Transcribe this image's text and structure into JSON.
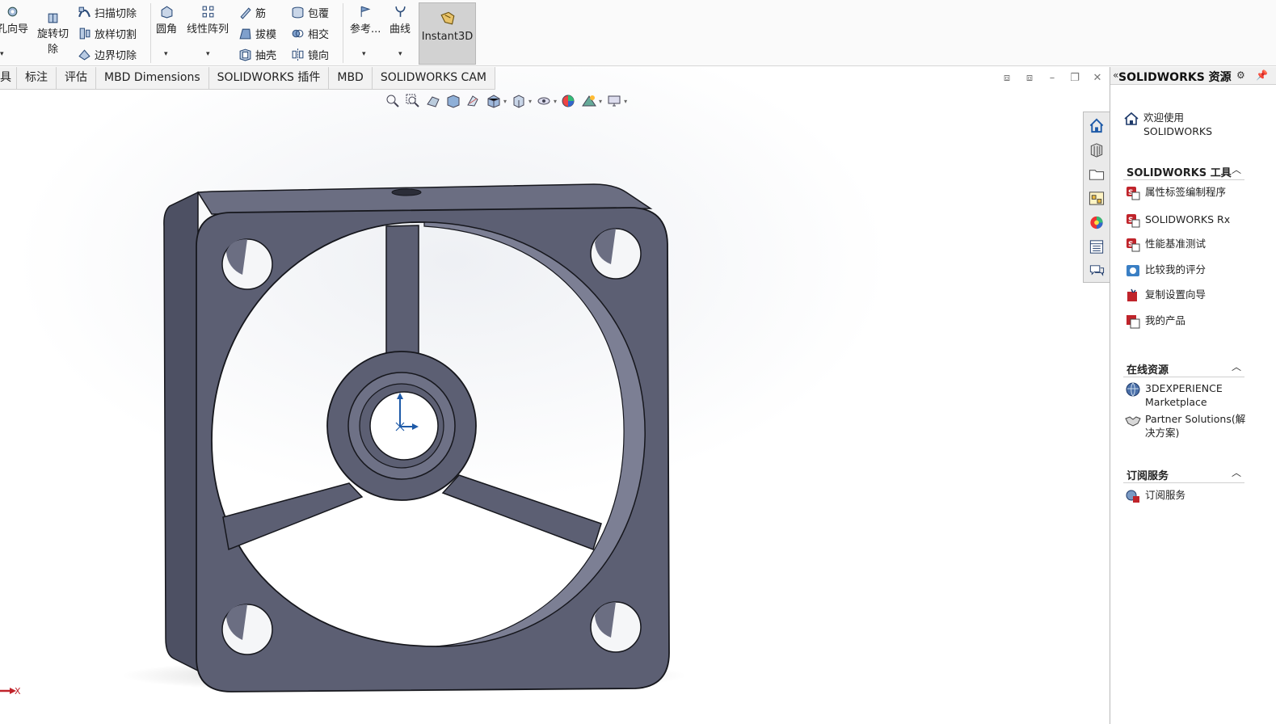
{
  "ribbon": {
    "hole_wizard": "孔向导",
    "revolve_cut_line1": "旋转切",
    "revolve_cut_line2": "除",
    "sweep_cut": "扫描切除",
    "loft_cut": "放样切割",
    "boundary_cut": "边界切除",
    "fillet": "圆角",
    "linear_pattern": "线性阵列",
    "rib": "筋",
    "draft": "拔模",
    "shell": "抽壳",
    "wrap": "包覆",
    "intersect": "相交",
    "mirror": "镜向",
    "reference": "参考...",
    "curves": "曲线",
    "instant3d": "Instant3D"
  },
  "tabs": [
    {
      "label": "具"
    },
    {
      "label": "标注"
    },
    {
      "label": "评估"
    },
    {
      "label": "MBD Dimensions"
    },
    {
      "label": "SOLIDWORKS 插件"
    },
    {
      "label": "MBD"
    },
    {
      "label": "SOLIDWORKS CAM"
    }
  ],
  "triad_x_label": "X",
  "panel": {
    "title": "SOLIDWORKS 资源",
    "welcome_line1": "欢迎使用",
    "welcome_line2": "SOLIDWORKS",
    "tools": {
      "title": "SOLIDWORKS 工具",
      "items": [
        "属性标签编制程序",
        "SOLIDWORKS Rx",
        "性能基准测试",
        "比较我的评分",
        "复制设置向导",
        "我的产品"
      ]
    },
    "online": {
      "title": "在线资源",
      "item1_line1": "3DEXPERIENCE",
      "item1_line2": "Marketplace",
      "item2_line1": "Partner Solutions(解",
      "item2_line2": "决方案)"
    },
    "subscription": {
      "title": "订阅服务",
      "items": [
        "订阅服务"
      ]
    }
  },
  "colors": {
    "model_face": "#5c5f73",
    "model_edge": "#16171d",
    "accent_blue": "#1e5aa8",
    "tool_red": "#c0242b"
  }
}
